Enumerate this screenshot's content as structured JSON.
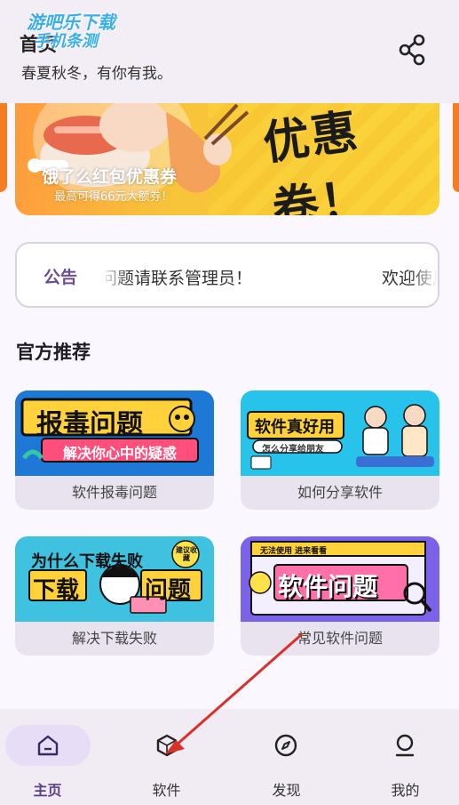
{
  "watermark": {
    "line1": "游吧乐下载",
    "line2": "手机条测"
  },
  "header": {
    "title": "首页",
    "subtitle": "春夏秋冬，有你有我。",
    "share_icon": "share-icon"
  },
  "banner": {
    "title": "饿了么红包优惠券",
    "subtitle": "最高可得66元大额券！",
    "big_text": "优惠卷！"
  },
  "notice": {
    "label": "公告",
    "text": "问题请联系管理员！",
    "text2": "欢迎使用"
  },
  "section": {
    "title": "官方推荐",
    "cards": [
      {
        "caption": "软件报毒问题",
        "img_title": "报毒问题",
        "img_sub": "解决你心中的疑惑"
      },
      {
        "caption": "如何分享软件",
        "img_title": "软件真好用",
        "img_sub": "怎么分享给朋友"
      },
      {
        "caption": "解决下载失败",
        "img_top": "为什么下载失败",
        "img_title": "下载",
        "img_title2": "问题",
        "img_badge": "建议收藏"
      },
      {
        "caption": "常见软件问题",
        "img_top": "无法使用 进来看看",
        "img_title": "软件问题"
      }
    ]
  },
  "bottom_nav": {
    "items": [
      {
        "label": "主页",
        "icon": "home-icon",
        "active": true
      },
      {
        "label": "软件",
        "icon": "cube-icon",
        "active": false
      },
      {
        "label": "发现",
        "icon": "compass-icon",
        "active": false
      },
      {
        "label": "我的",
        "icon": "person-icon",
        "active": false
      }
    ]
  },
  "colors": {
    "accent": "#5a3e8c",
    "nav_pill": "#e8ddf7",
    "arrow": "#d9302a"
  }
}
